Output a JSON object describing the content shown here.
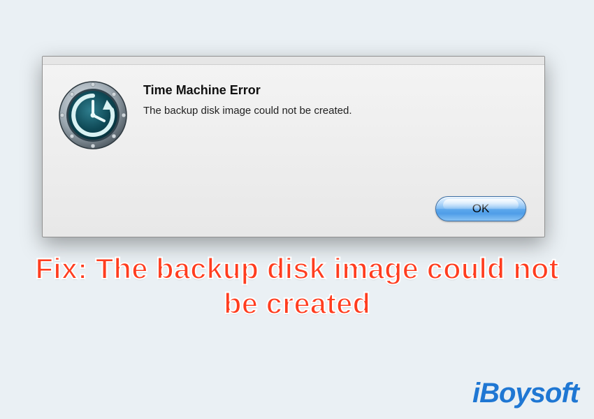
{
  "dialog": {
    "title": "Time Machine Error",
    "message": "The backup disk image could not be created.",
    "ok_label": "OK",
    "icon_name": "time-machine-icon"
  },
  "caption": "Fix: The backup disk image could not be created",
  "watermark": "iBoysoft",
  "colors": {
    "page_bg": "#eaf0f4",
    "caption_color": "#ff3d1f",
    "watermark_color": "#1f77d3",
    "button_border": "#3b6fa6"
  }
}
